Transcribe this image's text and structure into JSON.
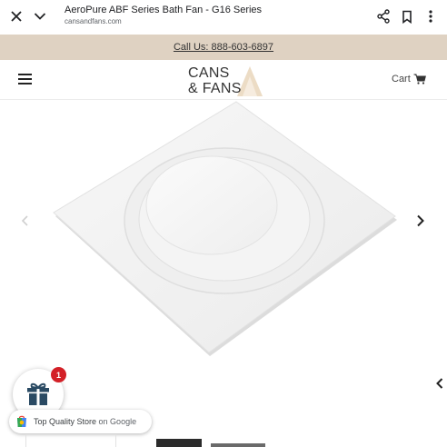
{
  "browser": {
    "title": "AeroPure ABF Series Bath Fan - G16 Series",
    "url": "cansandfans.com",
    "icons": [
      "close-icon",
      "chevron-down-icon",
      "share-icon",
      "bookmark-icon",
      "more-vert-icon"
    ]
  },
  "promo": {
    "call_text": "Call Us: 888-603-6897",
    "background": "#dfd2c2"
  },
  "header": {
    "logo_line1": "CANS",
    "logo_line2": "& FANS",
    "cart_label": "Cart",
    "logo_accent": "#e8d7c0"
  },
  "gallery": {
    "icons": [
      "chevron-left-icon",
      "chevron-right-icon"
    ]
  },
  "rewards": {
    "badge_count": "1",
    "badge_color": "#d32027"
  },
  "trust": {
    "label_main": "Top Quality Store",
    "label_sub": " on Google"
  }
}
